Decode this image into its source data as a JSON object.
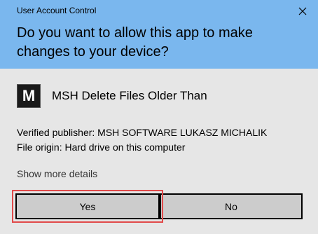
{
  "window": {
    "title": "User Account Control",
    "close_icon": "close-icon"
  },
  "prompt": {
    "question": "Do you want to allow this app to make changes to your device?"
  },
  "app": {
    "icon_letter": "M",
    "name": "MSH Delete Files Older Than"
  },
  "details": {
    "publisher_line": "Verified publisher: MSH SOFTWARE LUKASZ MICHALIK",
    "origin_line": "File origin: Hard drive on this computer",
    "show_more": "Show more details"
  },
  "buttons": {
    "yes": "Yes",
    "no": "No"
  },
  "colors": {
    "header_bg": "#7ab7ee",
    "body_bg": "#e6e6e6",
    "button_bg": "#cccccc",
    "highlight": "#e14a4a"
  }
}
